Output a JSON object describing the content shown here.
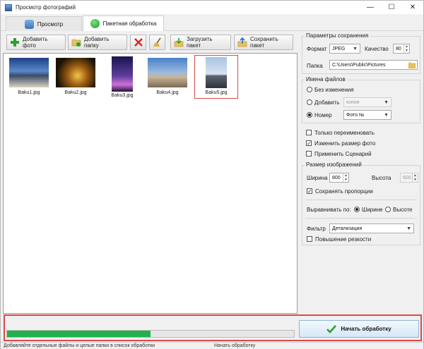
{
  "window": {
    "title": "Просмотр фотографий",
    "minimize": "—",
    "maximize": "☐",
    "close": "✕"
  },
  "tabs": [
    {
      "label": "Просмотр"
    },
    {
      "label": "Пакетная обработка"
    }
  ],
  "toolbar": {
    "add_photo": "Добавить фото",
    "add_folder": "Добавить папку",
    "load_batch": "Загрузить пакет",
    "save_batch": "Сохранить пакет"
  },
  "thumbnails": [
    {
      "caption": "Baku1.jpg",
      "selected": false
    },
    {
      "caption": "Baku2.jpg",
      "selected": false
    },
    {
      "caption": "Baku3.jpg",
      "selected": false
    },
    {
      "caption": "Baku4.jpg",
      "selected": false
    },
    {
      "caption": "Baku5.jpg",
      "selected": true
    }
  ],
  "save_params": {
    "title": "Параметры сохранения",
    "format_label": "Формат",
    "format_value": "JPEG",
    "quality_label": "Качество",
    "quality_value": "80",
    "folder_label": "Папка",
    "folder_value": "C:\\Users\\Public\\Pictures"
  },
  "file_names": {
    "title": "Имена файлов",
    "no_change": "Без изменения",
    "add": "Добавить",
    "add_value": "копия",
    "number": "Номер",
    "number_value": "Фото №"
  },
  "options": {
    "rename_only": "Только переименовать",
    "resize": "Изменить размер фото",
    "apply_script": "Применить Сценарий"
  },
  "image_size": {
    "title": "Размер изображений",
    "width_label": "Ширина",
    "width_value": "800",
    "height_label": "Высота",
    "height_value": "600",
    "keep_ratio": "Сохранять пропорции",
    "align_label": "Выравнивать по:",
    "align_width": "Ширине",
    "align_height": "Высоте",
    "filter_label": "Фильтр",
    "filter_value": "Детализация",
    "sharpen": "Повышение резкости"
  },
  "action": {
    "start": "Начать обработку",
    "progress_percent": 50
  },
  "status": {
    "left": "Добавляйте отдельные файлы и целые папки в список обработки",
    "right": "Начать обработку"
  }
}
